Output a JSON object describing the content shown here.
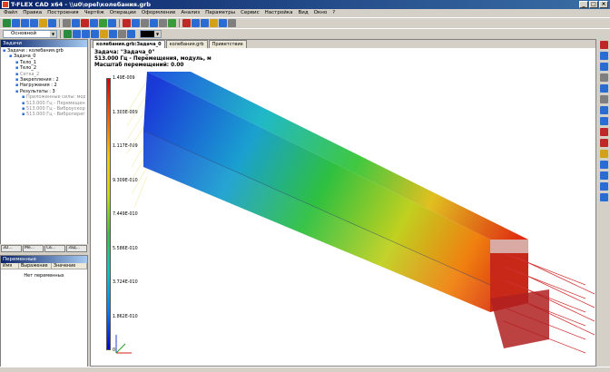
{
  "window": {
    "title": "T-FLEX CAD x64 - \\\\u0\\opel\\колебания.grb",
    "controls": [
      "_",
      "□",
      "×"
    ]
  },
  "menu": [
    "Файл",
    "Правка",
    "Построения",
    "Чертёж",
    "Операции",
    "Оформление",
    "Анализ",
    "Параметры",
    "Сервис",
    "Настройка",
    "Вид",
    "Окно",
    "?"
  ],
  "toolbar": {
    "layer_value": "Основной",
    "icon_colors": [
      "#2b8a3e",
      "#2b6cd4",
      "#2b6cd4",
      "#2b6cd4",
      "#d4a017",
      "#2b6cd4",
      "#7f7f7f",
      "#2b6cd4",
      "#c02828",
      "#2b6cd4",
      "#3a9b3a",
      "#2b6cd4",
      "#c02828",
      "#2b6cd4",
      "#7f7f7f",
      "#2b6cd4",
      "#7f7f7f",
      "#3a9b3a",
      "#c02828",
      "#2b6cd4",
      "#2b6cd4",
      "#d4a017",
      "#2b6cd4",
      "#7f7f7f"
    ]
  },
  "left_panel": {
    "title": "Задачи",
    "tree": [
      {
        "text": "Задачи : колебания.grb",
        "indent": 0,
        "muted": false
      },
      {
        "text": "Задача_0",
        "indent": 1,
        "muted": false
      },
      {
        "text": "Тело_1",
        "indent": 2,
        "muted": false
      },
      {
        "text": "Тело_2",
        "indent": 2,
        "muted": false
      },
      {
        "text": "Сетка_2",
        "indent": 2,
        "muted": true
      },
      {
        "text": "Закрепления : 2",
        "indent": 2,
        "muted": false
      },
      {
        "text": "Нагружения : 2",
        "indent": 2,
        "muted": false
      },
      {
        "text": "Результаты : 3",
        "indent": 2,
        "muted": false
      },
      {
        "text": "Приложенные силы: модуль: 5н",
        "indent": 3,
        "muted": true
      },
      {
        "text": "513.000 Гц - Перемещения, мод",
        "indent": 3,
        "muted": true
      },
      {
        "text": "513.000 Гц - Виброускорение, м",
        "indent": 3,
        "muted": true
      },
      {
        "text": "513.000 Гц - Виброперегрузки,",
        "indent": 3,
        "muted": true
      }
    ],
    "tabs": [
      "3D...",
      "Ме...",
      "Св...",
      "Зад..."
    ]
  },
  "variables_panel": {
    "title": "Переменные",
    "columns": [
      "Имя",
      "Выражение",
      "Значение"
    ],
    "empty_text": "Нет переменных"
  },
  "document_tabs": [
    "колебания.grb:Задача_0",
    "колебания.grb",
    "Приветствие"
  ],
  "result": {
    "task": "Задача: \"Задача_0\"",
    "quantity": "513.000 Гц - Перемещения, модуль, м",
    "scale": "Масштаб перемещений: 0.00"
  },
  "colorbar": {
    "labels": [
      "1.49E-009",
      "1.303E-009",
      "1.117E-009",
      "9.309E-010",
      "7.449E-010",
      "5.586E-010",
      "3.724E-010",
      "1.862E-010",
      "0"
    ],
    "colors": [
      "#e00000",
      "#ff6000",
      "#ffc800",
      "#c8e000",
      "#40c040",
      "#00c8c8",
      "#0080ff",
      "#0000e0"
    ]
  },
  "right_toolbar": {
    "icon_colors": [
      "#c02828",
      "#2b6cd4",
      "#2b6cd4",
      "#7f7f7f",
      "#2b6cd4",
      "#7f7f7f",
      "#2b6cd4",
      "#2b6cd4",
      "#c02828",
      "#c02828",
      "#d4a017",
      "#2b6cd4",
      "#2b6cd4",
      "#2b6cd4",
      "#2b6cd4"
    ]
  }
}
